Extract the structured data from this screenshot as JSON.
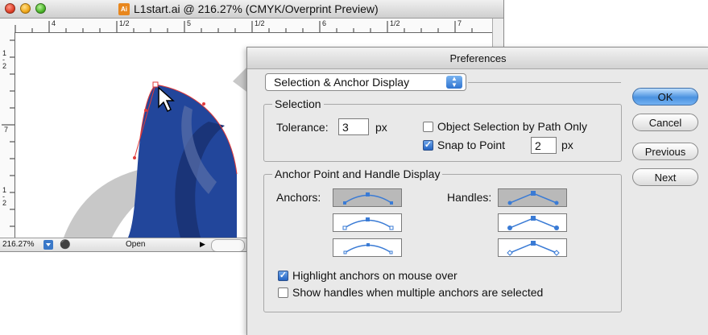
{
  "document": {
    "title": "L1start.ai @ 216.27% (CMYK/Overprint Preview)",
    "app_icon_text": "Ai",
    "ruler_top": [
      "4",
      "1/2",
      "5",
      "1/2",
      "6",
      "1/2",
      "7"
    ],
    "ruler_left": [
      "1 - 2",
      "7",
      "1 - 2"
    ],
    "zoom": "216.27%",
    "status": "Open",
    "colors": {
      "shape_blue": "#22469b",
      "shape_dark": "#1a3478",
      "swoosh_gray": "#c8c8c8",
      "path_red": "#e03a3a"
    }
  },
  "preferences": {
    "title": "Preferences",
    "pane": "Selection & Anchor Display",
    "selection": {
      "group_title": "Selection",
      "tolerance_label": "Tolerance:",
      "tolerance_value": "3",
      "tolerance_unit": "px",
      "object_selection_label": "Object Selection by Path Only",
      "object_selection_checked": false,
      "snap_label": "Snap to Point",
      "snap_checked": true,
      "snap_value": "2",
      "snap_unit": "px"
    },
    "anchor_display": {
      "group_title": "Anchor Point and Handle Display",
      "anchors_label": "Anchors:",
      "handles_label": "Handles:",
      "highlight_label": "Highlight anchors on mouse over",
      "highlight_checked": true,
      "show_handles_label": "Show handles when multiple anchors are selected",
      "show_handles_checked": false
    },
    "buttons": {
      "ok": "OK",
      "cancel": "Cancel",
      "previous": "Previous",
      "next": "Next"
    },
    "accent_color": "#3a7bd5"
  }
}
